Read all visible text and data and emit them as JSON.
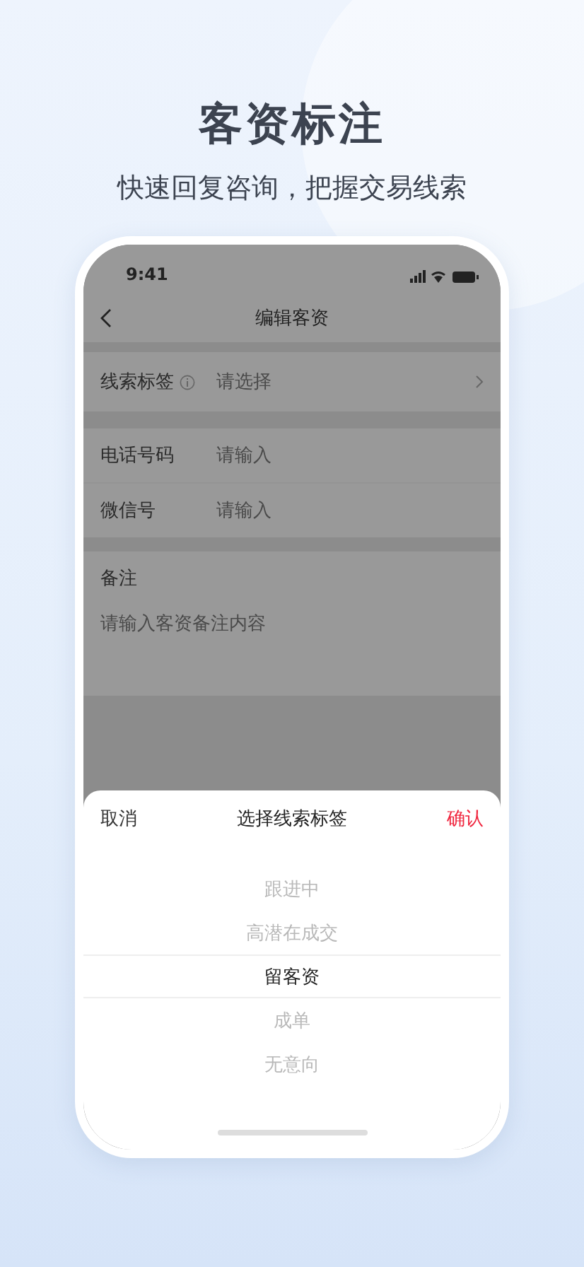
{
  "headline": "客资标注",
  "subtitle": "快速回复咨询，把握交易线索",
  "status_bar": {
    "time": "9:41"
  },
  "nav": {
    "title": "编辑客资"
  },
  "tag_field": {
    "label": "线索标签",
    "placeholder": "请选择"
  },
  "contact_fields": [
    {
      "label": "电话号码",
      "placeholder": "请输入"
    },
    {
      "label": "微信号",
      "placeholder": "请输入"
    }
  ],
  "remark": {
    "label": "备注",
    "placeholder": "请输入客资备注内容"
  },
  "sheet": {
    "cancel": "取消",
    "title": "选择线索标签",
    "confirm": "确认",
    "options": [
      {
        "label": "跟进中",
        "selected": false
      },
      {
        "label": "高潜在成交",
        "selected": false
      },
      {
        "label": "留客资",
        "selected": true
      },
      {
        "label": "成单",
        "selected": false
      },
      {
        "label": "无意向",
        "selected": false
      }
    ]
  }
}
